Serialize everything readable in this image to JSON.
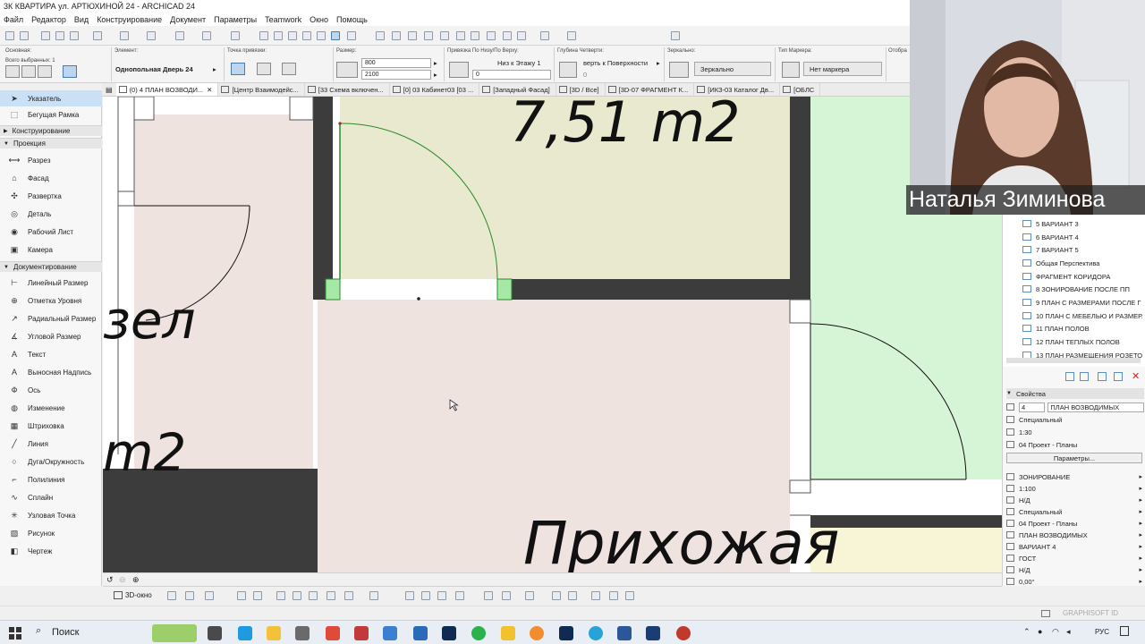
{
  "window": {
    "title": "3К КВАРТИРА ул. АРТЮХИНОЙ 24 - ARCHICAD 24"
  },
  "menu": [
    "Файл",
    "Редактор",
    "Вид",
    "Конструирование",
    "Документ",
    "Параметры",
    "Teamwork",
    "Окно",
    "Помощь"
  ],
  "infobox": {
    "main_label": "Основная:",
    "selected_label": "Всего выбранных: 1",
    "element_label": "Элемент:",
    "element_value": "Однопольная Дверь 24",
    "anchor_label": "Точка привязки:",
    "size_label": "Размер:",
    "width": "800",
    "height": "2100",
    "sill_label": "Привязка По Низу/По Верху:",
    "sill_value": "Низ к Этажу 1",
    "sill_offset": "0",
    "reveal_label": "Глубина Четверти:",
    "reveal_value": "верть к Поверхности",
    "reveal_offset": "0",
    "mirror_label": "Зеркально:",
    "mirror_value": "Зеркально",
    "marker_label": "Тип Маркера:",
    "marker_value": "Нет маркера",
    "display_label": "Отобра"
  },
  "toolbox": {
    "pointer": "Указатель",
    "marquee": "Бегущая Рамка",
    "cat_design": "Конструирование",
    "cat_viewpoint": "Проекция",
    "viewpoint_tools": [
      "Разрез",
      "Фасад",
      "Развертка",
      "Деталь",
      "Рабочий Лист",
      "Камера"
    ],
    "cat_document": "Документирование",
    "document_tools": [
      "Линейный Размер",
      "Отметка Уровня",
      "Радиальный Размер",
      "Угловой Размер",
      "Текст",
      "Выносная Надпись",
      "Ось",
      "Изменение",
      "Штриховка",
      "Линия",
      "Дуга/Окружность",
      "Полилиния",
      "Сплайн",
      "Узловая Точка",
      "Рисунок",
      "Чертеж"
    ]
  },
  "tabs": [
    "(0) 4 ПЛАН ВОЗВОДИ...",
    "[Центр Взаимодейс...",
    "[33 Схема включен...",
    "[0] 03 Кабинет03 [03 ...",
    "[Западный Фасад]",
    "[3D / Все]",
    "[3D-07 ФРАГМЕНТ К...",
    "[ИКЗ-03 Каталог Дв...",
    "[ОБЛС"
  ],
  "plan": {
    "area_text": "7,51 m2",
    "room_partial": "зел",
    "area_partial": "m2",
    "hall": "Прихожая"
  },
  "bottom": {
    "window_3d": "3D-окно"
  },
  "navigator": {
    "items": [
      "5 ВАРИАНТ 3",
      "6 ВАРИАНТ 4",
      "7 ВАРИАНТ 5",
      "Общая Перспектива",
      "ФРАГМЕНТ КОРИДОРА",
      "8 ЗОНИРОВАНИЕ ПОСЛЕ ПП",
      "9 ПЛАН С РАЗМЕРАМИ ПОСЛЕ Г",
      "10 ПЛАН С МЕБЕЛЬЮ И РАЗМЕР.",
      "11 ПЛАН ПОЛОВ",
      "12 ПЛАН ТЕПЛЫХ ПОЛОВ",
      "13 ПЛАН РАЗМЕЩЕНИЯ РОЗЕТО"
    ]
  },
  "properties": {
    "header": "Свойства",
    "id": "4",
    "name": "ПЛАН ВОЗВОДИМЫХ",
    "rows1": [
      "Специальный",
      "1:30",
      "04 Проект - Планы"
    ],
    "params_button": "Параметры...",
    "rows2": [
      "ЗОНИРОВАНИЕ",
      "1:100",
      "Н/Д",
      "Специальный",
      "04 Проект - Планы",
      "ПЛАН ВОЗВОДИМЫХ",
      "ВАРИАНТ 4",
      "ГОСТ",
      "Н/Д",
      "0,00°"
    ]
  },
  "status": {
    "brand": "GRAPHISOFT ID"
  },
  "taskbar": {
    "search": "Поиск",
    "lang": "РУС"
  },
  "webcam": {
    "name": "Наталья Зиминова"
  }
}
